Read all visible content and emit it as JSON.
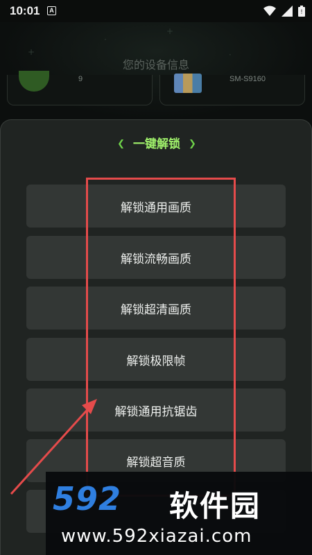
{
  "status_bar": {
    "time": "10:01",
    "notification_badge": "A",
    "icons": [
      "wifi-icon",
      "signal-icon",
      "battery-icon"
    ]
  },
  "header": {
    "title": "您的设备信息",
    "device_left_value": "9",
    "device_right_value": "SM-S9160"
  },
  "panel": {
    "title": "一键解锁",
    "title_color": "#9ff06b",
    "buttons": [
      {
        "label": "解锁通用画质"
      },
      {
        "label": "解锁流畅画质"
      },
      {
        "label": "解锁超清画质"
      },
      {
        "label": "解锁极限帧"
      },
      {
        "label": "解锁通用抗锯齿"
      },
      {
        "label": "解锁超音质"
      }
    ]
  },
  "annotation": {
    "highlight_color": "#e54b4b"
  },
  "watermark": {
    "logo_digits": "592",
    "logo_text": "软件园",
    "url": "www.592xiazai.com",
    "logo_color": "#2f7fe0"
  }
}
